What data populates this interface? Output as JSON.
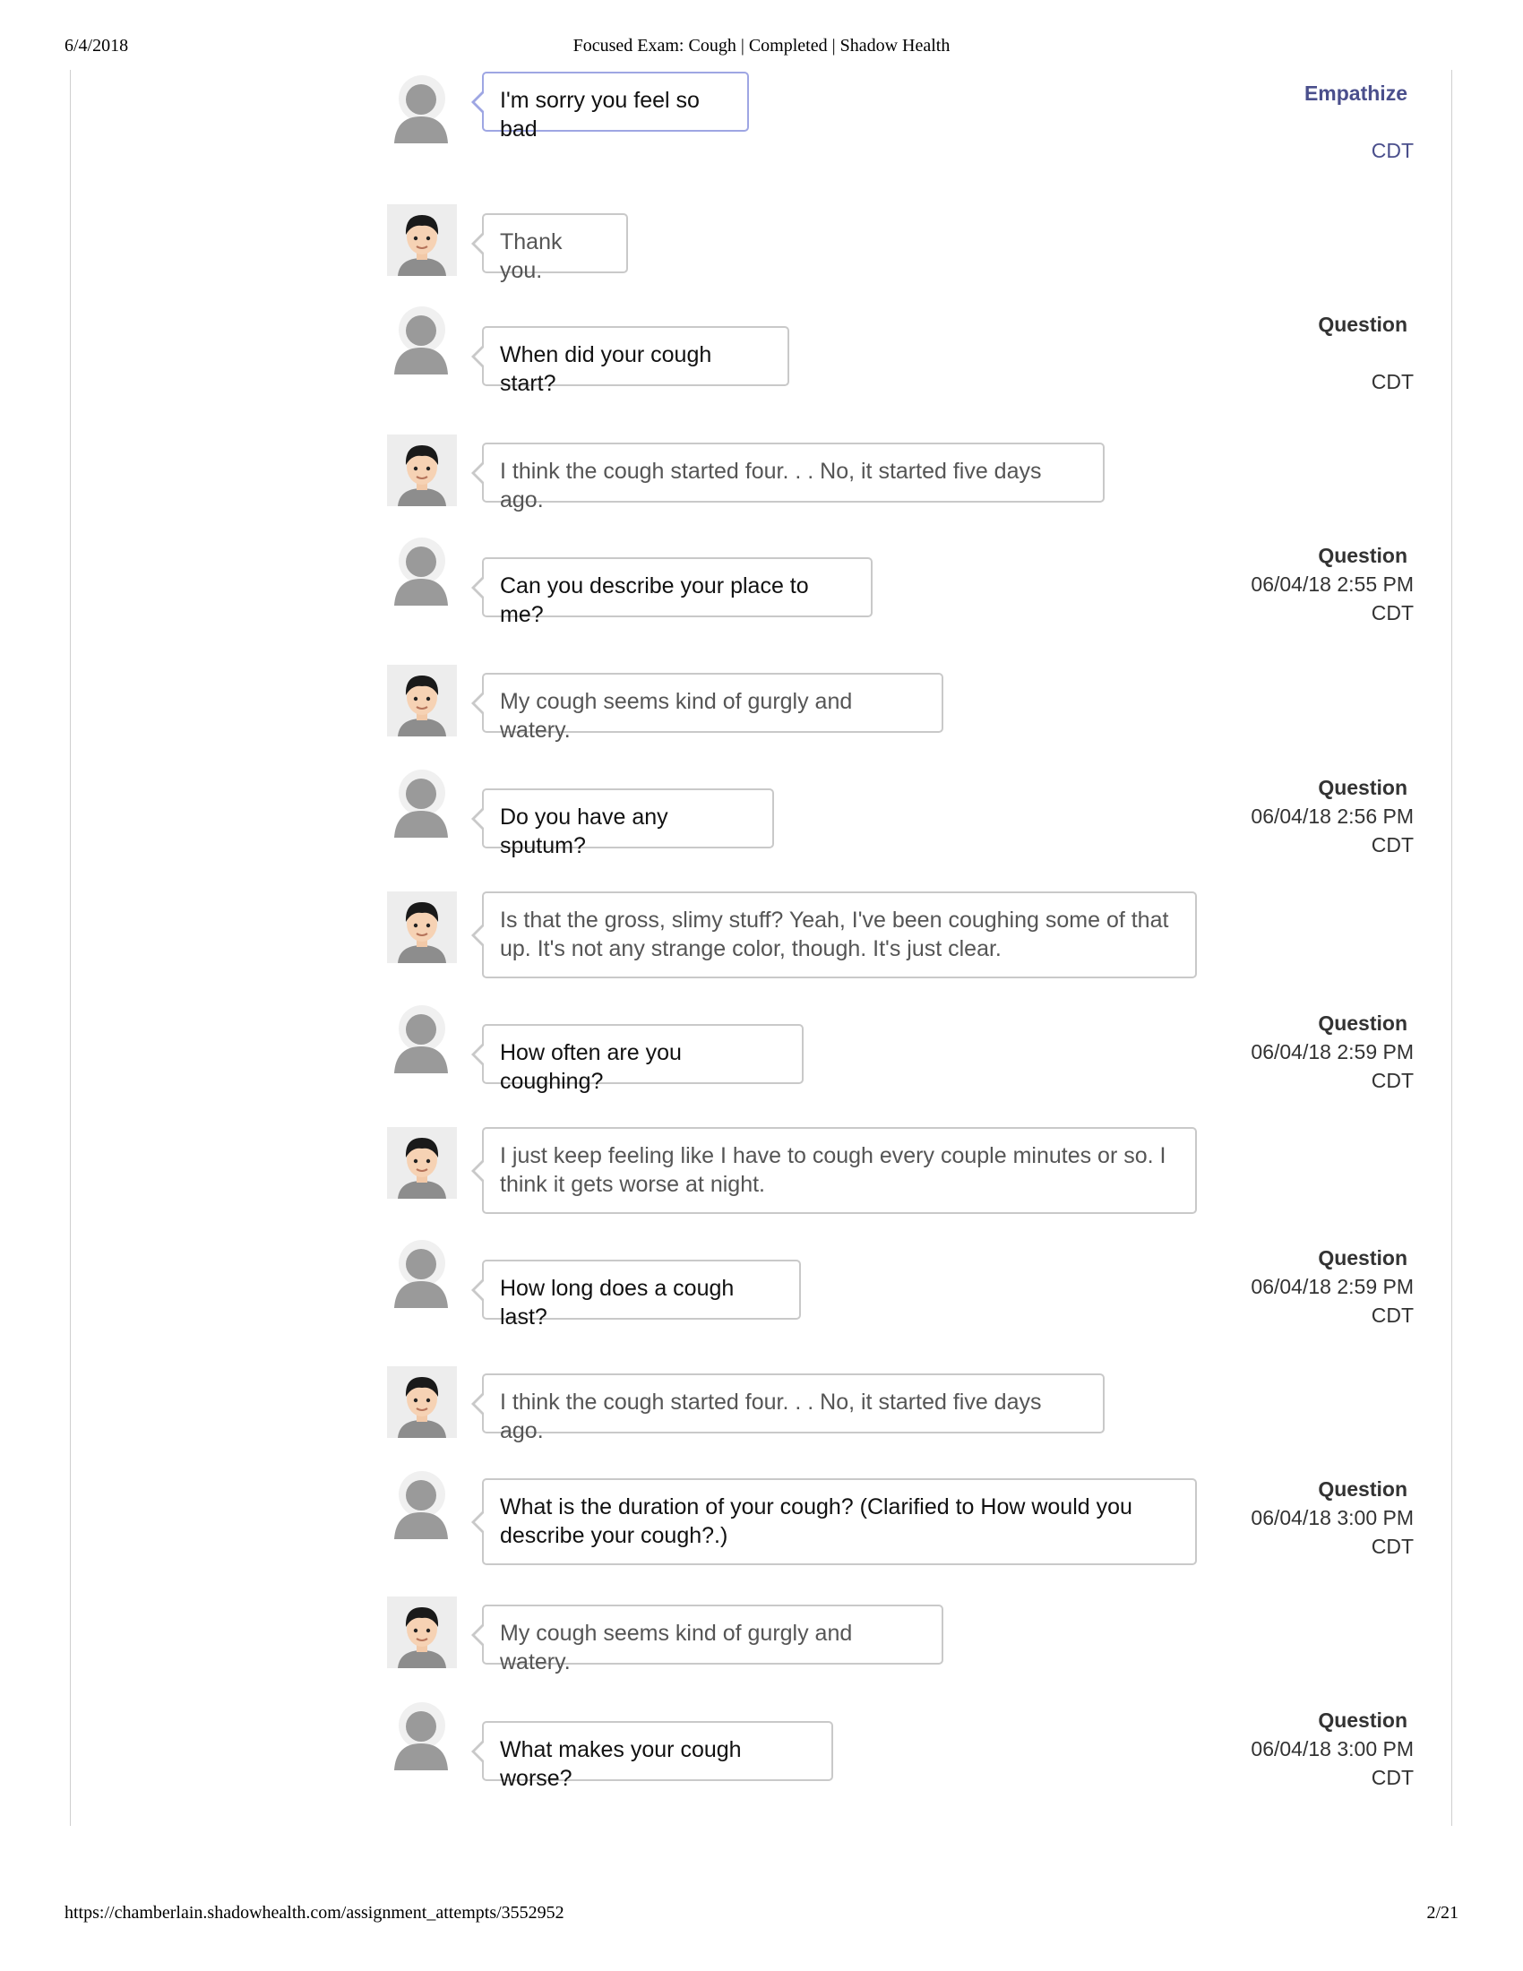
{
  "print_header": {
    "date": "6/4/2018",
    "title": "Focused Exam: Cough | Completed | Shadow Health"
  },
  "print_footer": {
    "url": "https://chamberlain.shadowhealth.com/assignment_attempts/3552952",
    "page": "2/21"
  },
  "icons": {
    "student_avatar": "person-silhouette-icon",
    "patient_avatar": "patient-boy-avatar-icon"
  },
  "colors": {
    "empathize_accent": "#4a4f8c",
    "highlight_border": "#9ea6e3",
    "bubble_border": "#c9c9c9"
  },
  "transcript": [
    {
      "speaker": "student",
      "text": "I'm sorry you feel so bad",
      "type": "Empathize",
      "date": "",
      "tz": "CDT"
    },
    {
      "speaker": "patient",
      "text": "Thank you."
    },
    {
      "speaker": "student",
      "text": "When did your cough start?",
      "type": "Question",
      "date": "",
      "tz": "CDT"
    },
    {
      "speaker": "patient",
      "text": "I think the cough started four. . . No, it started five days ago."
    },
    {
      "speaker": "student",
      "text": "Can you describe your place to me?",
      "type": "Question",
      "date": "06/04/18 2:55 PM",
      "tz": "CDT"
    },
    {
      "speaker": "patient",
      "text": "My cough seems kind of gurgly and watery."
    },
    {
      "speaker": "student",
      "text": "Do you have any sputum?",
      "type": "Question",
      "date": "06/04/18 2:56 PM",
      "tz": "CDT"
    },
    {
      "speaker": "patient",
      "text": "Is that the gross, slimy stuff? Yeah, I've been coughing some of that up. It's not any strange color, though. It's just clear."
    },
    {
      "speaker": "student",
      "text": "How often are you coughing?",
      "type": "Question",
      "date": "06/04/18 2:59 PM",
      "tz": "CDT"
    },
    {
      "speaker": "patient",
      "text": "I just keep feeling like I have to cough every couple minutes or so. I think it gets worse at night."
    },
    {
      "speaker": "student",
      "text": "How long does a cough last?",
      "type": "Question",
      "date": "06/04/18 2:59 PM",
      "tz": "CDT"
    },
    {
      "speaker": "patient",
      "text": "I think the cough started four. . . No, it started five days ago."
    },
    {
      "speaker": "student",
      "text": "What is the duration of your cough? (Clarified to How would you describe your cough?.)",
      "type": "Question",
      "date": "06/04/18 3:00 PM",
      "tz": "CDT"
    },
    {
      "speaker": "patient",
      "text": "My cough seems kind of gurgly and watery."
    },
    {
      "speaker": "student",
      "text": "What makes your cough worse?",
      "type": "Question",
      "date": "06/04/18 3:00 PM",
      "tz": "CDT"
    }
  ]
}
